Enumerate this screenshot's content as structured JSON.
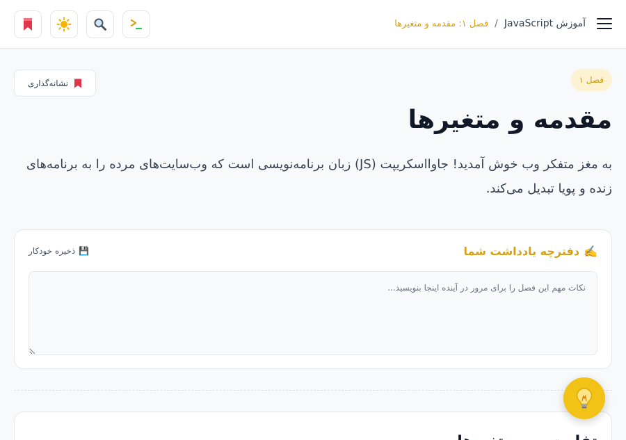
{
  "header": {
    "breadcrumb": {
      "home": "آموزش JavaScript",
      "separator": "/",
      "current": "فصل ۱: مقدمه و متغیرها"
    },
    "icons": {
      "menu": "hamburger-menu-icon",
      "terminal": "terminal-icon",
      "search": "search-icon",
      "theme": "sun-icon",
      "bookmark": "bookmark-icon"
    }
  },
  "chapter": {
    "badge": "فصل ۱",
    "title": "مقدمه و متغیرها",
    "intro": "به مغز متفکر وب خوش آمدید! جاوااسکریپت (JS) زبان برنامه‌نویسی است که وب‌سایت‌های مرده را به برنامه‌های زنده و پویا تبدیل می‌کند.",
    "bookmark_label": "نشانه‌گذاری"
  },
  "notes": {
    "title": "دفترچه یادداشت شما",
    "title_emoji": "✍️",
    "autosave_label": "ذخیره خودکار",
    "autosave_emoji": "💾",
    "placeholder": "نکات مهم این فصل را برای مرور در آینده اینجا بنویسید..."
  },
  "next_section": {
    "title": "تفاوت بین متغیرها"
  },
  "fab": {
    "icon": "lightbulb-icon"
  },
  "colors": {
    "accent": "#d4a017",
    "accent_bg": "#fdf3d2",
    "fab": "#f2c316",
    "bookmark_red": "#e0364b",
    "terminal_green": "#22c55e",
    "text_dark": "#111827"
  }
}
